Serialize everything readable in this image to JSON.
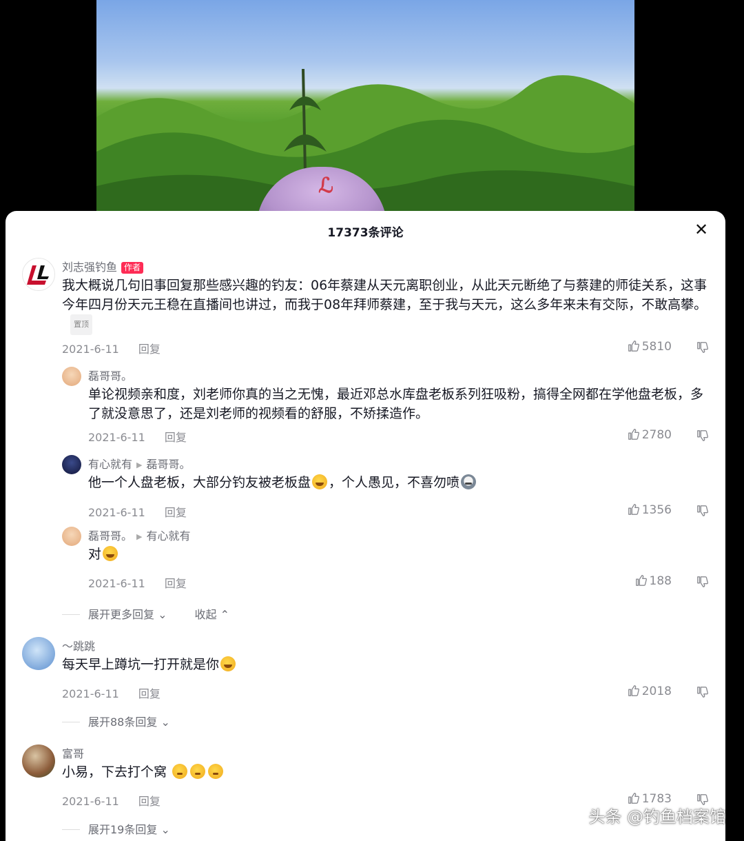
{
  "sheet": {
    "title": "17373条评论"
  },
  "comments": [
    {
      "user": "刘志强钓鱼",
      "badge": "作者",
      "text": "我大概说几句旧事回复那些感兴趣的钓友：06年蔡建从天元离职创业，从此天元断绝了与蔡建的师徒关系，这事今年四月份天元王稳在直播间也讲过，而我于08年拜师蔡建，至于我与天元，这么多年来未有交际，不敢高攀。",
      "pinned": "置顶",
      "date": "2021-6-11",
      "reply_label": "回复",
      "likes": "5810"
    },
    {
      "user": "磊哥哥。",
      "text": "单论视频亲和度，刘老师你真的当之无愧，最近邓总水库盘老板系列狂吸粉，搞得全网都在学他盘老板，多了就没意思了，还是刘老师的视频看的舒服，不矫揉造作。",
      "date": "2021-6-11",
      "reply_label": "回复",
      "likes": "2780"
    },
    {
      "user": "有心就有",
      "reply_to": "磊哥哥。",
      "text_a": "他一个人盘老板，大部分钓友被老板盘",
      "text_b": "，个人愚见，不喜勿喷",
      "date": "2021-6-11",
      "reply_label": "回复",
      "likes": "1356"
    },
    {
      "user": "磊哥哥。",
      "reply_to": "有心就有",
      "text": "对",
      "date": "2021-6-11",
      "reply_label": "回复",
      "likes": "188"
    },
    {
      "user": "～跳跳",
      "text": "每天早上蹲坑一打开就是你",
      "date": "2021-6-11",
      "reply_label": "回复",
      "likes": "2018"
    },
    {
      "user": "富哥",
      "text": "小易，下去打个窝",
      "date": "2021-6-11",
      "reply_label": "回复",
      "likes": "1783"
    }
  ],
  "expanders": {
    "more_replies": "展开更多回复",
    "collapse": "收起",
    "expand_88": "展开88条回复",
    "expand_19": "展开19条回复"
  },
  "watermark": "头条 @钓鱼档案馆",
  "colors": {
    "author_badge": "#fe2c55",
    "meta_gray": "#8a8b91"
  }
}
